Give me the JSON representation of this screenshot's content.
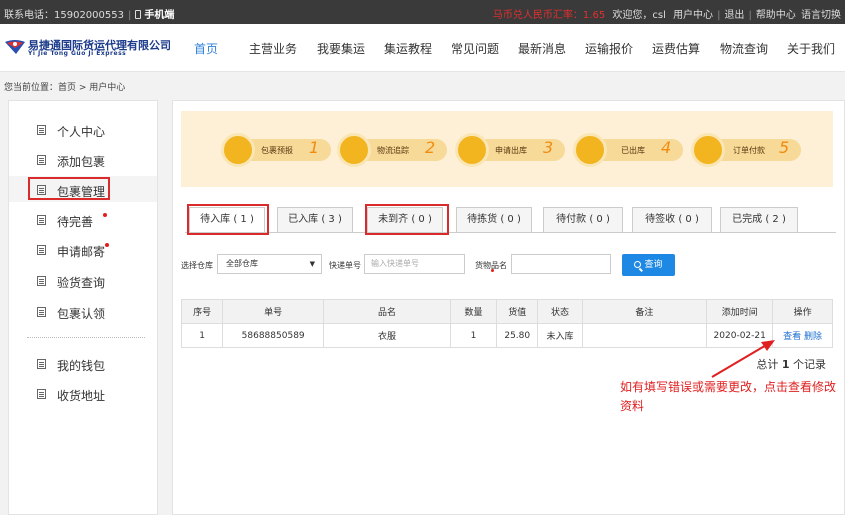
{
  "topbar": {
    "contact": "联系电话：15902000553",
    "mobile": "手机端",
    "rate": "马币兑人民币汇率：1.65",
    "welcome": "欢迎您，csl",
    "user_center": "用户中心",
    "logout": "退出",
    "help": "帮助中心",
    "language": "语言切换"
  },
  "logo": {
    "cn": "易捷通国际货运代理有限公司",
    "en": "Yi Jie Tong Guo Ji Express"
  },
  "nav": [
    "首页",
    "主营业务",
    "我要集运",
    "集运教程",
    "常见问题",
    "最新消息",
    "运输报价",
    "运费估算",
    "物流查询",
    "关于我们"
  ],
  "breadcrumb": "您当前位置：首页 > 用户中心",
  "sidebar": {
    "items": [
      "个人中心",
      "添加包裹",
      "包裹管理",
      "待完善",
      "申请邮寄",
      "验货查询",
      "包裹认领"
    ],
    "items2": [
      "我的钱包",
      "收货地址"
    ]
  },
  "steps": [
    {
      "label": "包裹预报",
      "num": "1"
    },
    {
      "label": "物流追踪",
      "num": "2"
    },
    {
      "label": "申请出库",
      "num": "3"
    },
    {
      "label": "已出库",
      "num": "4"
    },
    {
      "label": "订单付款",
      "num": "5"
    }
  ],
  "tabs": [
    "待入库 ( 1 )",
    "已入库 ( 3 )",
    "未到齐 ( 0 )",
    "待拣货 ( 0 )",
    "待付款 ( 0 )",
    "待签收 ( 0 )",
    "已完成 ( 2 )"
  ],
  "filters": {
    "warehouse_label": "选择仓库",
    "warehouse_value": "全部仓库",
    "tracking_label": "快递单号",
    "tracking_placeholder": "输入快递单号",
    "goods_label": "货物品名",
    "search": "查询"
  },
  "table": {
    "headers": [
      "序号",
      "单号",
      "品名",
      "数量",
      "货值",
      "状态",
      "备注",
      "添加时间",
      "操作"
    ],
    "rows": [
      {
        "idx": "1",
        "order": "58688850589",
        "name": "衣服",
        "qty": "1",
        "value": "25.80",
        "status": "未入库",
        "note": "",
        "date": "2020-02-21",
        "view": "查看",
        "del": "删除"
      }
    ]
  },
  "total": {
    "prefix": "总计",
    "count": "1",
    "suffix": "个记录"
  },
  "annotation": "如有填写错误或需要更改，点击查看修改资料",
  "colors": {
    "accent": "#2f7fd8",
    "highlight": "#d92b2b",
    "button": "#1e88e5"
  }
}
